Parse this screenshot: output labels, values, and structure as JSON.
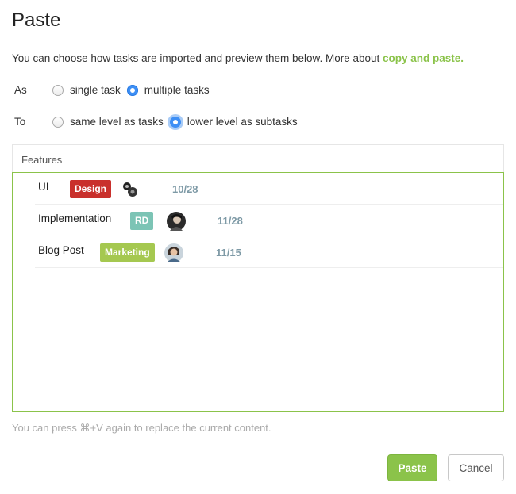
{
  "dialog": {
    "title": "Paste",
    "intro_text": "You can choose how tasks are imported and preview them below. More about ",
    "intro_link": "copy and paste."
  },
  "as_row": {
    "label": "As",
    "options": [
      {
        "label": "single task",
        "checked": false
      },
      {
        "label": "multiple tasks",
        "checked": true
      }
    ]
  },
  "to_row": {
    "label": "To",
    "options": [
      {
        "label": "same level as tasks",
        "checked": false
      },
      {
        "label": "lower level as subtasks",
        "checked": true
      }
    ]
  },
  "preview": {
    "header": "Features",
    "tasks": [
      {
        "name": "UI",
        "badge": "Design",
        "badge_color": "#c9302c",
        "date": "10/28"
      },
      {
        "name": "Implementation",
        "badge": "RD",
        "badge_color": "#7cc4b5",
        "date": "11/28"
      },
      {
        "name": "Blog Post",
        "badge": "Marketing",
        "badge_color": "#a5c850",
        "date": "11/15"
      }
    ]
  },
  "hint": "You can press ⌘+V again to replace the current content.",
  "buttons": {
    "paste": "Paste",
    "cancel": "Cancel"
  },
  "colors": {
    "accent_green": "#8bc34a",
    "radio_blue": "#3d8ff5",
    "date_color": "#7e9aa6"
  }
}
